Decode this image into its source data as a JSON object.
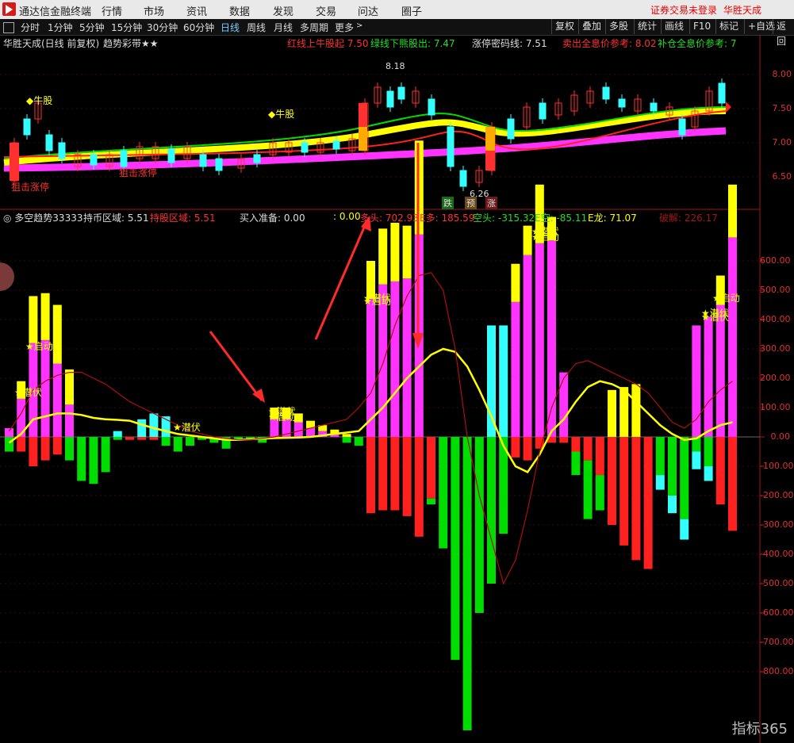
{
  "menubar": {
    "app": "通达信金融终端",
    "menus": [
      "行情",
      "市场",
      "资讯",
      "数据",
      "发现",
      "交易",
      "问达",
      "圈子"
    ],
    "notice": "证券交易未登录",
    "brand": "华胜天成"
  },
  "toolbar": {
    "periods": [
      "分时",
      "1分钟",
      "5分钟",
      "15分钟",
      "30分钟",
      "60分钟",
      "日线",
      "周线",
      "月线",
      "多周期",
      "更多"
    ],
    "active": "日线",
    "right_buttons": [
      "复权",
      "叠加",
      "多股",
      "统计",
      "画线",
      "F10",
      "标记",
      "+自选",
      "返回"
    ]
  },
  "upper_panel": {
    "title": "华胜天成(日线 前复权)",
    "indicator": "趋势彩带★★",
    "texts": {
      "red_line": "红线上牛股起 7.50",
      "green_line": "绿线下熊股出: 7.47",
      "zt_line": "涨停密码线: 7.51",
      "sell_ref": "卖出全息价参考: 8.02",
      "buy_ref": "补仓全息价参考: 7"
    },
    "y_ticks": [
      "8.00",
      "7.50",
      "7.00",
      "6.50"
    ],
    "labels": {
      "high": "8.18",
      "low": "6.26",
      "niugu1": "牛股",
      "niugu2": "牛股",
      "zhangting1": "狙击涨停",
      "zhangting2": "狙击涨停",
      "die": "跌",
      "yu": "预",
      "zhang": "涨"
    },
    "colors": {
      "magenta": "#ff33ff",
      "yellow": "#ffff00",
      "green": "#00dd00",
      "red": "#ff2020",
      "cyan": "#33ffff"
    }
  },
  "lower_panel": {
    "title": "多空趋势33333",
    "holdcoin": "持币区域: 5.51",
    "holdstock": "持股区域: 5.51",
    "buyprep": "买入准备: 0.00",
    "zero": ": 0.00",
    "duotou": "多头: 702.93",
    "eduo": "E多: 185.59",
    "kongtou": "空头: -315.32",
    "ekong": "E空: -85.11",
    "elong": "E龙: 71.07",
    "jiejie": "破解: 226.17",
    "signals": {
      "s1": "潜伏",
      "s2": "启动",
      "s3": "潜伏",
      "s4": "潜伏",
      "s5": "启动",
      "s6": "潜伏",
      "s7": "启动",
      "s8": "潜伏",
      "s9": "启动",
      "s10": "潜伏",
      "s11": "启动",
      "s12": "潜伏"
    }
  },
  "chart_data": {
    "type": "bar",
    "title": "多空趋势33333",
    "ylim": [
      -750,
      700
    ],
    "y_ticks": [
      600,
      500,
      400,
      300,
      200,
      100,
      0,
      -100,
      -200,
      -300,
      -400,
      -500,
      -600,
      -700,
      -800
    ],
    "y_tick_labels": [
      "600.00",
      "500.00",
      "400.00",
      "300.00",
      "200.00",
      "100.00",
      "0.00",
      "-100.00",
      "-200.00",
      "-300.00",
      "-400.00",
      "-500.00",
      "-600.00",
      "-700.00",
      "-800.00"
    ],
    "x_count": 61,
    "series": [
      {
        "name": "多头",
        "color": "#ff33ff",
        "values": [
          30,
          130,
          320,
          330,
          250,
          110,
          0,
          0,
          0,
          0,
          0,
          0,
          0,
          0,
          0,
          0,
          0,
          0,
          0,
          0,
          0,
          0,
          60,
          60,
          50,
          30,
          20,
          10,
          0,
          0,
          470,
          520,
          530,
          540,
          690,
          0,
          0,
          0,
          0,
          0,
          0,
          0,
          460,
          620,
          660,
          670,
          220,
          0,
          0,
          0,
          0,
          0,
          0,
          0,
          0,
          0,
          0,
          380,
          410,
          450,
          680
        ]
      },
      {
        "name": "E多",
        "color": "#ffff00",
        "values": [
          0,
          60,
          160,
          160,
          200,
          120,
          0,
          0,
          0,
          0,
          0,
          0,
          0,
          0,
          0,
          0,
          0,
          0,
          0,
          0,
          0,
          0,
          40,
          40,
          30,
          25,
          20,
          15,
          10,
          0,
          130,
          190,
          200,
          180,
          320,
          0,
          0,
          0,
          0,
          0,
          0,
          0,
          130,
          100,
          200,
          80,
          0,
          0,
          0,
          0,
          160,
          170,
          180,
          0,
          0,
          0,
          0,
          0,
          0,
          100,
          180
        ]
      },
      {
        "name": "空头",
        "color": "#ff2020",
        "values": [
          0,
          -50,
          -100,
          -80,
          -60,
          0,
          0,
          0,
          0,
          0,
          -10,
          -10,
          -10,
          0,
          0,
          0,
          0,
          0,
          0,
          0,
          0,
          0,
          0,
          0,
          0,
          0,
          0,
          0,
          0,
          0,
          -260,
          -250,
          -250,
          -270,
          -340,
          -210,
          0,
          0,
          0,
          0,
          0,
          0,
          -70,
          -80,
          -40,
          -20,
          -20,
          -50,
          -80,
          -130,
          -300,
          -370,
          -420,
          -450,
          0,
          0,
          0,
          0,
          0,
          -230,
          -320
        ]
      },
      {
        "name": "E空",
        "color": "#00dd00",
        "values": [
          -50,
          0,
          0,
          0,
          0,
          -80,
          -150,
          -160,
          -120,
          -10,
          0,
          0,
          0,
          -30,
          -50,
          -30,
          -10,
          -20,
          -40,
          -10,
          -5,
          -20,
          0,
          0,
          0,
          0,
          0,
          0,
          -20,
          -30,
          0,
          0,
          0,
          0,
          0,
          -20,
          -380,
          -760,
          -1000,
          -600,
          -500,
          -330,
          0,
          0,
          0,
          0,
          0,
          -80,
          -200,
          -120,
          0,
          0,
          0,
          0,
          -130,
          -200,
          -280,
          -50,
          -100,
          0,
          0
        ]
      },
      {
        "name": "E龙",
        "color": "#33ffff",
        "values": [
          0,
          0,
          0,
          0,
          0,
          0,
          0,
          0,
          0,
          20,
          0,
          60,
          80,
          70,
          0,
          0,
          0,
          0,
          0,
          0,
          0,
          0,
          0,
          0,
          0,
          0,
          0,
          0,
          0,
          0,
          0,
          0,
          0,
          0,
          0,
          0,
          0,
          0,
          0,
          0,
          380,
          380,
          0,
          0,
          0,
          0,
          0,
          0,
          0,
          0,
          0,
          0,
          0,
          0,
          -50,
          -60,
          -70,
          -60,
          -50,
          0,
          0
        ]
      }
    ],
    "lines": [
      {
        "name": "yellow",
        "color": "#ffff00",
        "values": [
          -20,
          10,
          60,
          70,
          80,
          80,
          75,
          65,
          60,
          58,
          55,
          42,
          30,
          20,
          10,
          5,
          0,
          -5,
          -10,
          -10,
          -8,
          -6,
          -4,
          -3,
          -2,
          0,
          5,
          10,
          15,
          20,
          60,
          100,
          150,
          200,
          240,
          280,
          300,
          290,
          240,
          160,
          70,
          -30,
          -100,
          -120,
          -60,
          20,
          60,
          120,
          170,
          190,
          180,
          160,
          120,
          80,
          40,
          10,
          -10,
          -5,
          20,
          40,
          50
        ]
      },
      {
        "name": "darkred",
        "color": "#aa1010",
        "values": [
          20,
          80,
          160,
          190,
          210,
          220,
          220,
          200,
          180,
          150,
          120,
          100,
          80,
          60,
          40,
          20,
          10,
          0,
          -5,
          -10,
          -10,
          -5,
          0,
          10,
          20,
          30,
          40,
          50,
          60,
          100,
          150,
          250,
          380,
          480,
          550,
          560,
          500,
          300,
          0,
          -200,
          -350,
          -500,
          -420,
          -250,
          -50,
          100,
          200,
          250,
          260,
          240,
          220,
          200,
          180,
          150,
          100,
          50,
          30,
          60,
          120,
          160,
          190
        ]
      }
    ]
  },
  "watermark": "指标365"
}
